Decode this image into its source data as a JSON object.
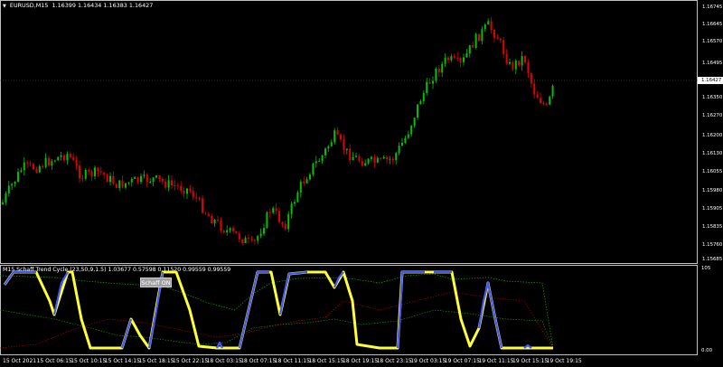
{
  "header": {
    "symbol": "EURUSD,M15",
    "ohlc": "1.16399 1.16434 1.16383 1.16427",
    "indicator_title": "M15 Schaff Trend Cycle (23,50,9,1.5) 1.03677 0.57598 0.11520 0.99559 0.99559"
  },
  "button": {
    "label": "Schaff ON"
  },
  "price_axis": {
    "labels": [
      "1.16745",
      "1.16645",
      "1.16570",
      "1.16495",
      "1.16350",
      "1.16270",
      "1.16200",
      "1.16130",
      "1.16055",
      "1.15980",
      "1.15905",
      "1.15835",
      "1.15760",
      "1.15685"
    ],
    "current": "1.16427"
  },
  "indicator_axis": {
    "top": "105",
    "bottom": "0.00"
  },
  "time_axis": {
    "labels": [
      "15 Oct 2021",
      "15 Oct 06:15",
      "15 Oct 10:15",
      "15 Oct 14:15",
      "15 Oct 18:15",
      "15 Oct 22:15",
      "18 Oct 03:15",
      "18 Oct 07:15",
      "18 Oct 11:15",
      "18 Oct 15:15",
      "18 Oct 19:15",
      "18 Oct 23:15",
      "19 Oct 03:15",
      "19 Oct 07:15",
      "19 Oct 11:15",
      "19 Oct 15:15",
      "19 Oct 19:15"
    ]
  },
  "colors": {
    "bull": "#00c000",
    "bear": "#e00000",
    "schaff_main": "#ffff33",
    "schaff_up": "#4455ff",
    "level_green": "#00b000",
    "level_red": "#c00000",
    "frame": "#c0c0c0"
  }
}
